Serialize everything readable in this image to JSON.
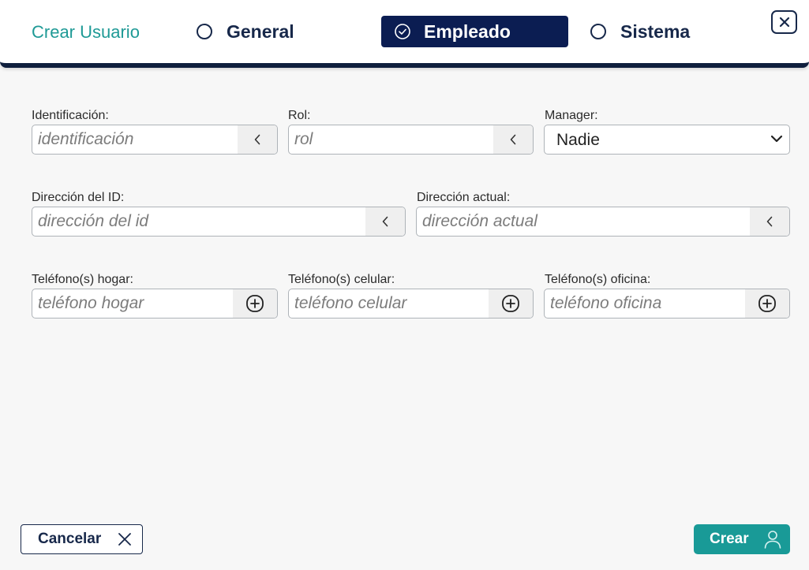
{
  "header": {
    "title": "Crear Usuario",
    "tabs": [
      {
        "label": "General",
        "selected": false
      },
      {
        "label": "Empleado",
        "selected": true
      },
      {
        "label": "Sistema",
        "selected": false
      }
    ]
  },
  "form": {
    "identificacion": {
      "label": "Identificación:",
      "placeholder": "identificación",
      "value": ""
    },
    "rol": {
      "label": "Rol:",
      "placeholder": "rol",
      "value": ""
    },
    "manager": {
      "label": "Manager:",
      "value": "Nadie"
    },
    "direccion_id": {
      "label": "Dirección del ID:",
      "placeholder": "dirección del id",
      "value": ""
    },
    "direccion_actual": {
      "label": "Dirección actual:",
      "placeholder": "dirección actual",
      "value": ""
    },
    "telefono_hogar": {
      "label": "Teléfono(s) hogar:",
      "placeholder": "teléfono hogar",
      "value": ""
    },
    "telefono_celular": {
      "label": "Teléfono(s) celular:",
      "placeholder": "teléfono celular",
      "value": ""
    },
    "telefono_oficina": {
      "label": "Teléfono(s) oficina:",
      "placeholder": "teléfono oficina",
      "value": ""
    }
  },
  "footer": {
    "cancel_label": "Cancelar",
    "create_label": "Crear"
  },
  "icons": {
    "close": "close-icon",
    "chevron_left": "chevron-left-icon",
    "chevron_down": "chevron-down-icon",
    "plus": "plus-circle-icon",
    "x": "x-icon",
    "user": "user-icon",
    "check": "check-circle-icon"
  },
  "colors": {
    "accent_teal": "#1f9a96",
    "navy": "#0b1d52",
    "text_dark": "#17284a"
  }
}
